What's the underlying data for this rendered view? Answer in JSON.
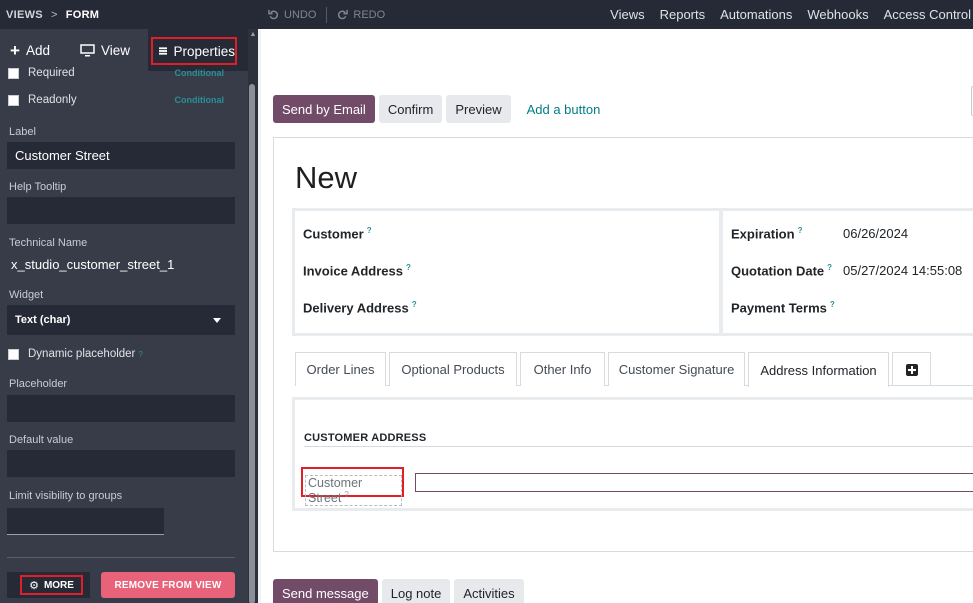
{
  "topbar": {
    "breadcrumb": [
      "VIEWS",
      "FORM"
    ],
    "breadcrumb_sep": ">",
    "undo_label": "UNDO",
    "redo_label": "REDO",
    "nav": [
      "Views",
      "Reports",
      "Automations",
      "Webhooks",
      "Access Control"
    ]
  },
  "sidebar": {
    "tabs": {
      "add": "Add",
      "view": "View",
      "properties": "Properties"
    },
    "required_label": "Required",
    "readonly_label": "Readonly",
    "conditional": "Conditional",
    "label_title": "Label",
    "label_value": "Customer Street",
    "tooltip_title": "Help Tooltip",
    "tooltip_value": "",
    "technical_title": "Technical Name",
    "technical_value": "x_studio_customer_street_1",
    "widget_title": "Widget",
    "widget_value": "Text (char)",
    "dynamic_placeholder": "Dynamic placeholder",
    "placeholder_title": "Placeholder",
    "placeholder_value": "",
    "default_title": "Default value",
    "default_value": "",
    "groups_title": "Limit visibility to groups",
    "groups_value": "",
    "more_label": "MORE",
    "remove_label": "REMOVE FROM VIEW",
    "help_mark": "?"
  },
  "main": {
    "buttons": [
      "Send by Email",
      "Confirm",
      "Preview"
    ],
    "add_button": "Add a button",
    "title": "New",
    "left_fields": [
      {
        "label": "Customer",
        "value": ""
      },
      {
        "label": "Invoice Address",
        "value": ""
      },
      {
        "label": "Delivery Address",
        "value": ""
      }
    ],
    "right_fields": [
      {
        "label": "Expiration",
        "value": "06/26/2024"
      },
      {
        "label": "Quotation Date",
        "value": "05/27/2024 14:55:08"
      },
      {
        "label": "Payment Terms",
        "value": ""
      }
    ],
    "tabs": [
      "Order Lines",
      "Optional Products",
      "Other Info",
      "Customer Signature",
      "Address Information"
    ],
    "active_tab": "Address Information",
    "section_title": "CUSTOMER ADDRESS",
    "street_label": "Customer Street",
    "street_value": "",
    "chatter": [
      "Send message",
      "Log note",
      "Activities"
    ]
  },
  "colors": {
    "primary": "#714b67",
    "link": "#017e84",
    "sidebar_bg": "#383c48",
    "topbar_bg": "#262a36",
    "danger": "#e8627a",
    "highlight": "#e01f26"
  }
}
